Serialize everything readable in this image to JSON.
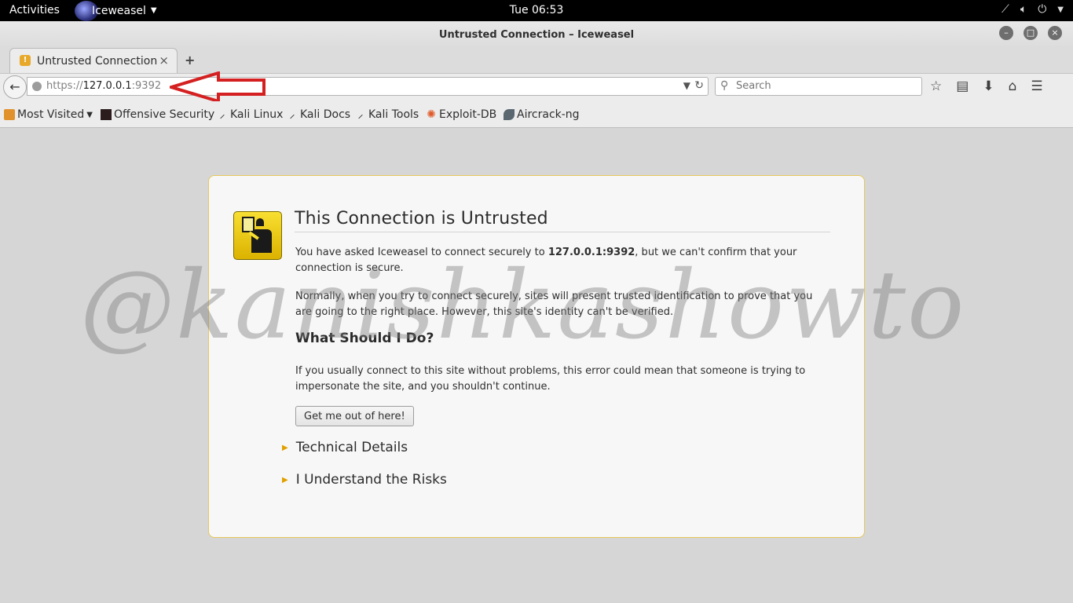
{
  "topbar": {
    "activities": "Activities",
    "app_name": "Iceweasel",
    "clock": "Tue 06:53"
  },
  "window": {
    "title": "Untrusted Connection – Iceweasel"
  },
  "tab": {
    "label": "Untrusted Connection",
    "close": "×",
    "new_tab": "+"
  },
  "navbar": {
    "url_proto": "https://",
    "url_host": "127.0.0.1",
    "url_port": ":9392",
    "search_placeholder": "Search"
  },
  "bookmarks": [
    {
      "label": "Most Visited",
      "icon": "folder-icon"
    },
    {
      "label": "Offensive Security",
      "icon": "offsec-icon"
    },
    {
      "label": "Kali Linux",
      "icon": "kali-dragon-icon"
    },
    {
      "label": "Kali Docs",
      "icon": "kali-dragon-icon"
    },
    {
      "label": "Kali Tools",
      "icon": "kali-dragon-icon"
    },
    {
      "label": "Exploit-DB",
      "icon": "exploitdb-icon"
    },
    {
      "label": "Aircrack-ng",
      "icon": "aircrack-icon"
    }
  ],
  "error_page": {
    "title": "This Connection is Untrusted",
    "p1_before": "You have asked Iceweasel to connect securely to ",
    "p1_host": "127.0.0.1:9392",
    "p1_after": ", but we can't confirm that your connection is secure.",
    "p2": "Normally, when you try to connect securely, sites will present trusted identification to prove that you are going to the right place. However, this site's identity can't be verified.",
    "heading2": "What Should I Do?",
    "p3": "If you usually connect to this site without problems, this error could mean that someone is trying to impersonate the site, and you shouldn't continue.",
    "button": "Get me out of here!",
    "technical_details": "Technical Details",
    "understand_risks": "I Understand the Risks"
  },
  "watermark": "@kanishkashowto",
  "colors": {
    "card_border": "#e7c75e",
    "badge_yellow": "#f8df31",
    "annotation_arrow": "#d42020"
  }
}
